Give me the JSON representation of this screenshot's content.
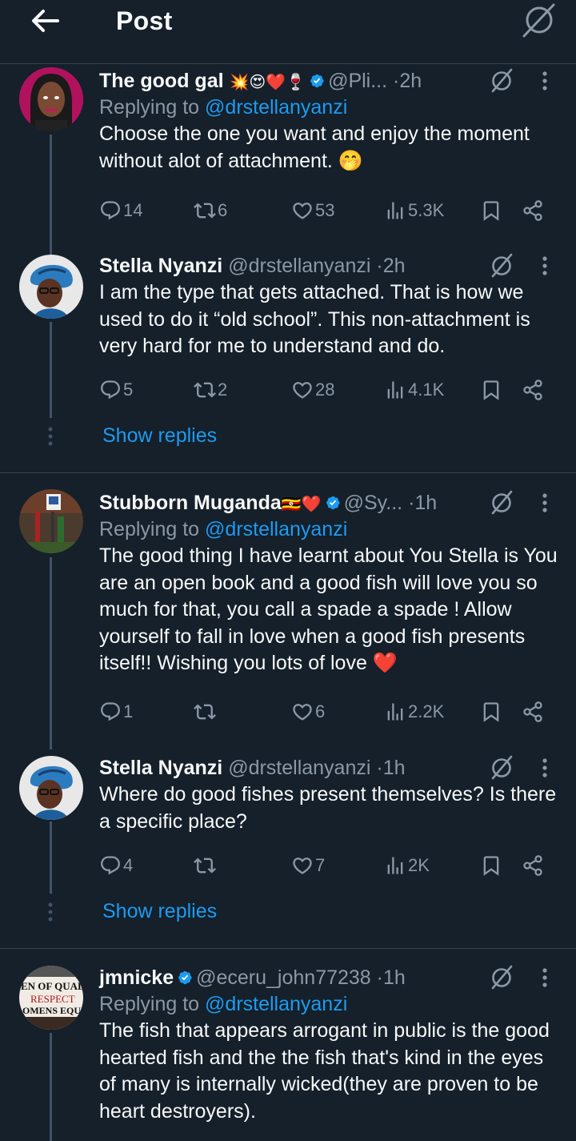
{
  "header": {
    "title": "Post"
  },
  "tweets": [
    {
      "name": "The good gal",
      "name_emojis": "💥😍❤️🍷",
      "verified": true,
      "handle": "@Pli...",
      "dot": "·",
      "time": "2h",
      "replying_prefix": "Replying to ",
      "replying_to": "@drstellanyanzi",
      "text": "Choose the one you want and enjoy the moment without alot of attachment. 🤭",
      "replies": "14",
      "retweets": "6",
      "likes": "53",
      "views": "5.3K"
    },
    {
      "name": "Stella Nyanzi",
      "handle": "@drstellanyanzi",
      "dot": "·",
      "time": "2h",
      "text": "I am the type that gets attached. That is how we used to do it “old school”. This non-attachment is very hard for me to understand and do.",
      "replies": "5",
      "retweets": "2",
      "likes": "28",
      "views": "4.1K"
    },
    {
      "name": "Stubborn Muganda",
      "name_emojis": "🇺🇬❤️",
      "verified": true,
      "handle": "@Sy...",
      "dot": "·",
      "time": "1h",
      "replying_prefix": "Replying to ",
      "replying_to": "@drstellanyanzi",
      "text": "The good thing I have learnt about You Stella is You are an open book and a good fish will love you so much for that, you call a spade a  spade ! Allow yourself to fall in love when a good fish presents itself!! Wishing you lots of love ❤️",
      "replies": "1",
      "retweets": "",
      "likes": "6",
      "views": "2.2K"
    },
    {
      "name": "Stella Nyanzi",
      "handle": "@drstellanyanzi",
      "dot": "·",
      "time": "1h",
      "text": "Where do good fishes present themselves? Is there a specific place?",
      "replies": "4",
      "retweets": "",
      "likes": "7",
      "views": "2K"
    },
    {
      "name": "jmnicke",
      "verified": true,
      "handle": "@eceru_john77238",
      "dot": "·",
      "time": "1h",
      "replying_prefix": "Replying to ",
      "replying_to": "@drstellanyanzi",
      "text": "The fish that appears arrogant in public is the good hearted fish and the the fish that's kind in the eyes of many is internally wicked(they are proven to  be heart destroyers)."
    }
  ],
  "show_replies_label": "Show replies",
  "avatar_sign_text": [
    "EN OF QUAL",
    "RESPECT",
    "OMENS EQU"
  ],
  "colors": {
    "background": "#15202b",
    "accent": "#1d9bf0",
    "muted": "#8b98a5",
    "divider": "#38444d",
    "heart": "#f91880"
  }
}
